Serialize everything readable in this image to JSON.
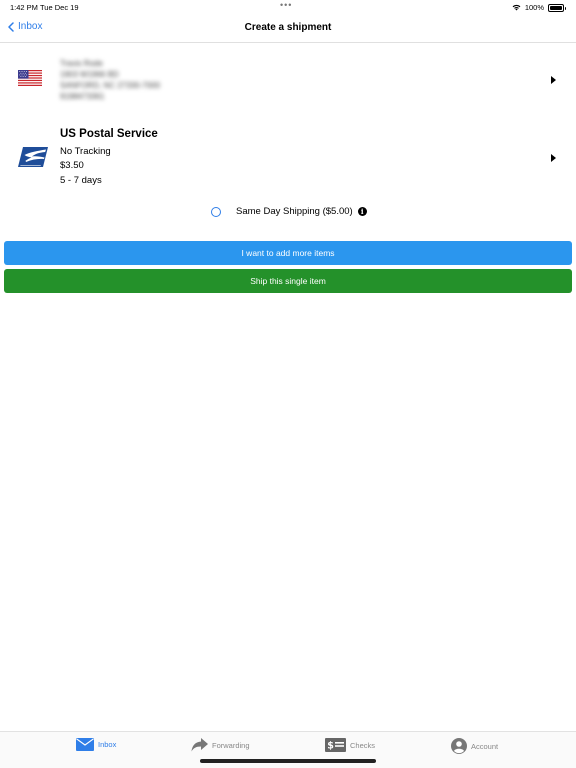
{
  "status_bar": {
    "time": "1:42 PM",
    "date": "Tue Dec 19",
    "dots": "•••",
    "battery": "100%",
    "wifi_icon": "wifi-icon",
    "battery_icon": "battery-icon"
  },
  "nav": {
    "back_label": "Inbox",
    "title": "Create a shipment"
  },
  "address": {
    "flag_icon": "us-flag-icon",
    "lines": [
      "Travis Rode",
      "1903 W1966 BD",
      "SANFORD, NC 27330-7000",
      "9198473361"
    ]
  },
  "shipping": {
    "carrier_icon": "usps-eagle-icon",
    "carrier": "US Postal Service",
    "tracking": "No Tracking",
    "price": "$3.50",
    "days": "5 - 7 days"
  },
  "same_day": {
    "label": "Same Day Shipping ($5.00)",
    "selected": false,
    "info_icon": "info-icon"
  },
  "buttons": {
    "add_more": "I want to add more items",
    "ship_single": "Ship this single item"
  },
  "tabs": [
    {
      "label": "Inbox",
      "icon": "mail-icon",
      "active": true
    },
    {
      "label": "Forwarding",
      "icon": "forward-arrow-icon",
      "active": false
    },
    {
      "label": "Checks",
      "icon": "check-icon",
      "active": false
    },
    {
      "label": "Account",
      "icon": "user-icon",
      "active": false
    }
  ],
  "colors": {
    "accent": "#2f7ee8",
    "blue_button": "#2b96ee",
    "green_button": "#24912a"
  }
}
